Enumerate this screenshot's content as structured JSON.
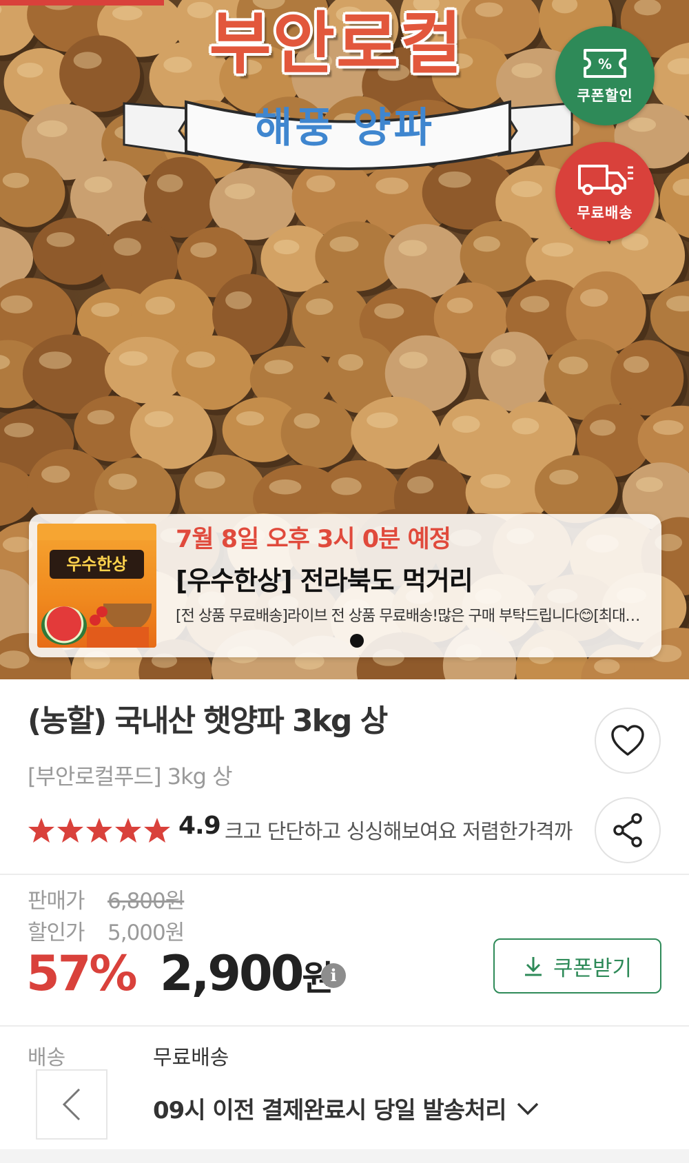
{
  "hero": {
    "brand_title": "부안로컬",
    "ribbon_text": "해풍 양파",
    "badges": {
      "coupon_label": "쿠폰할인",
      "coupon_icon": "%",
      "shipping_label": "무료배송"
    },
    "colors": {
      "coupon_badge": "#2e8a58",
      "shipping_badge": "#d9413b",
      "brand_title": "#e2573c",
      "ribbon_text": "#3f86cf"
    }
  },
  "live": {
    "thumb_title": "우수한상",
    "date": "7월 8일 오후 3시 0분 예정",
    "title": "[우수한상] 전라북도 먹거리",
    "description": "[전 상품 무료배송]라이브 전 상품 무료배송!많은 구매 부탁드립니다😊[최대…"
  },
  "product": {
    "name": "(농할) 국내산 햇양파 3kg 상",
    "seller_line": "[부안로컬푸드] 3kg 상",
    "rating": "4.9",
    "star_count": 5,
    "review_snippet": "크고 단단하고 싱싱해보여요 저렴한가격까"
  },
  "price": {
    "sale_label": "판매가",
    "sale_value": "6,800원",
    "discount_label": "할인가",
    "discount_value": "5,000원",
    "rate": "57%",
    "final_amount": "2,900",
    "final_unit": "원",
    "info_icon": "i",
    "coupon_button": "쿠폰받기",
    "accent_color": "#d9413b"
  },
  "shipping": {
    "label": "배송",
    "value": "무료배송",
    "note": "09시 이전 결제완료시 당일 발송처리"
  }
}
